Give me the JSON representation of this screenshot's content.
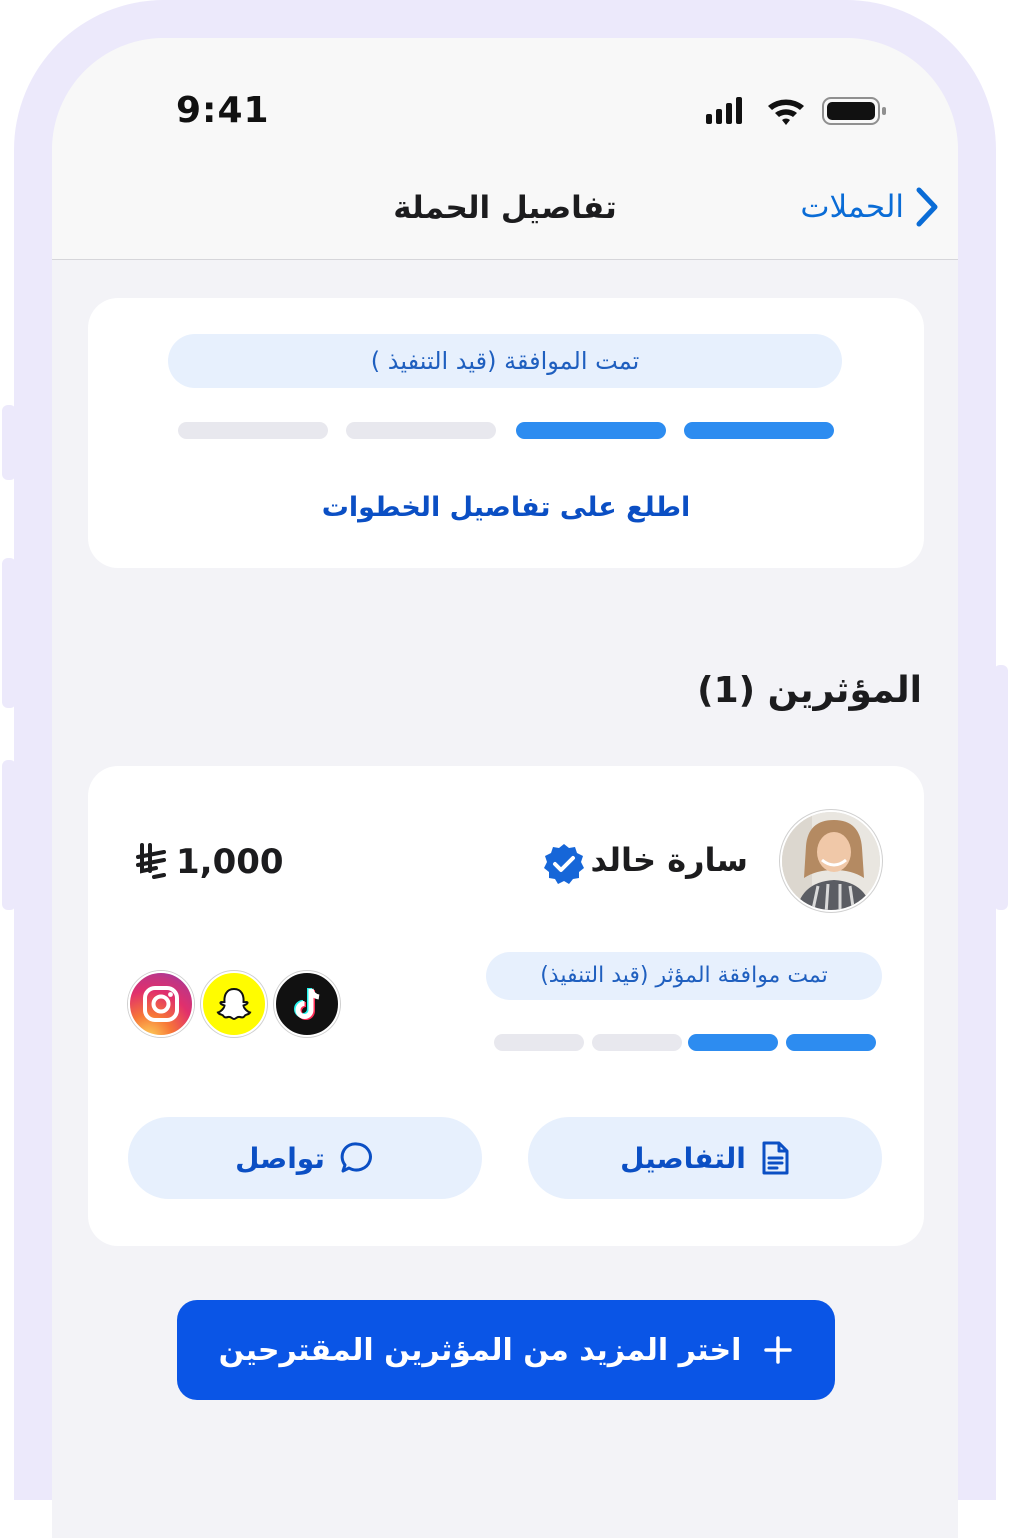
{
  "status_bar": {
    "time": "9:41"
  },
  "nav": {
    "title": "تفاصيل الحملة",
    "back_label": "الحملات"
  },
  "campaign_status": {
    "label": "تمت الموافقة (قيد التنفيذ )",
    "steps_total": 4,
    "steps_completed": 2,
    "link": "اطلع على تفاصيل الخطوات"
  },
  "influencers_section": {
    "title": "المؤثرين (1)"
  },
  "influencer": {
    "name": "سارة خالد",
    "verified": true,
    "price": "1,000",
    "currency_icon": "saudi-riyal-icon",
    "status": "تمت موافقة المؤثر (قيد التنفيذ)",
    "steps_total": 4,
    "steps_completed": 2,
    "socials": [
      "tiktok-icon",
      "snapchat-icon",
      "instagram-icon"
    ],
    "details_label": "التفاصيل",
    "contact_label": "تواصل"
  },
  "cta": {
    "label": "اختر المزيد من المؤثرين المقترحين"
  },
  "colors": {
    "primary": "#0a55e6",
    "link": "#0b4fc4",
    "step_done": "#2d8cf0",
    "step_todo": "#e8e8ee",
    "pill_bg": "#e7f0fd"
  }
}
